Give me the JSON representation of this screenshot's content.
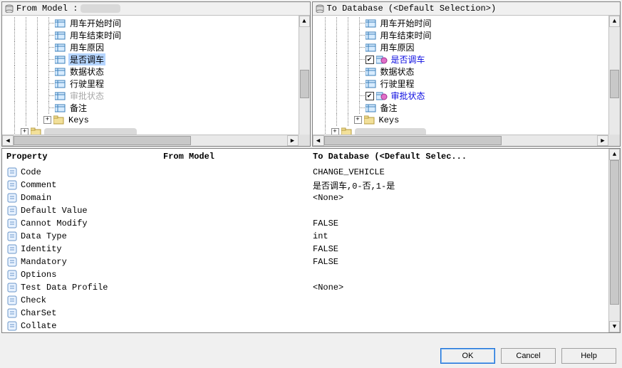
{
  "left_panel": {
    "title_prefix": "From Model :",
    "items": [
      {
        "label": "用车开始时间",
        "style": "normal"
      },
      {
        "label": "用车结束时间",
        "style": "normal"
      },
      {
        "label": "用车原因",
        "style": "normal"
      },
      {
        "label": "是否调车",
        "style": "selected"
      },
      {
        "label": "数据状态",
        "style": "normal"
      },
      {
        "label": "行驶里程",
        "style": "normal"
      },
      {
        "label": "审批状态",
        "style": "greyed"
      },
      {
        "label": "备注",
        "style": "normal"
      }
    ],
    "keys_label": "Keys"
  },
  "right_panel": {
    "title": "To Database (<Default Selection>)",
    "items": [
      {
        "label": "用车开始时间",
        "style": "normal",
        "checkbox": false,
        "pink": false
      },
      {
        "label": "用车结束时间",
        "style": "normal",
        "checkbox": false,
        "pink": false
      },
      {
        "label": "用车原因",
        "style": "normal",
        "checkbox": false,
        "pink": false
      },
      {
        "label": "是否调车",
        "style": "blue",
        "checkbox": true,
        "pink": true
      },
      {
        "label": "数据状态",
        "style": "normal",
        "checkbox": false,
        "pink": false
      },
      {
        "label": "行驶里程",
        "style": "normal",
        "checkbox": false,
        "pink": false
      },
      {
        "label": "审批状态",
        "style": "blue",
        "checkbox": true,
        "pink": true
      },
      {
        "label": "备注",
        "style": "normal",
        "checkbox": false,
        "pink": false
      }
    ],
    "keys_label": "Keys"
  },
  "properties": {
    "header": {
      "c1": "Property",
      "c2": "From Model",
      "c3": "To Database (<Default Selec..."
    },
    "rows": [
      {
        "name": "Code",
        "model": "",
        "db": "CHANGE_VEHICLE"
      },
      {
        "name": "Comment",
        "model": "",
        "db": "是否调车,0-否,1-是"
      },
      {
        "name": "Domain",
        "model": "",
        "db": "<None>"
      },
      {
        "name": "Default Value",
        "model": "",
        "db": ""
      },
      {
        "name": "Cannot Modify",
        "model": "",
        "db": "FALSE"
      },
      {
        "name": "Data Type",
        "model": "",
        "db": "int"
      },
      {
        "name": "Identity",
        "model": "",
        "db": "FALSE"
      },
      {
        "name": "Mandatory",
        "model": "",
        "db": "FALSE"
      },
      {
        "name": "Options",
        "model": "",
        "db": ""
      },
      {
        "name": "Test Data Profile",
        "model": "",
        "db": "<None>"
      },
      {
        "name": "Check",
        "model": "",
        "db": ""
      },
      {
        "name": "CharSet",
        "model": "",
        "db": ""
      },
      {
        "name": "Collate",
        "model": "",
        "db": ""
      }
    ]
  },
  "buttons": {
    "ok": "OK",
    "cancel": "Cancel",
    "help": "Help"
  }
}
